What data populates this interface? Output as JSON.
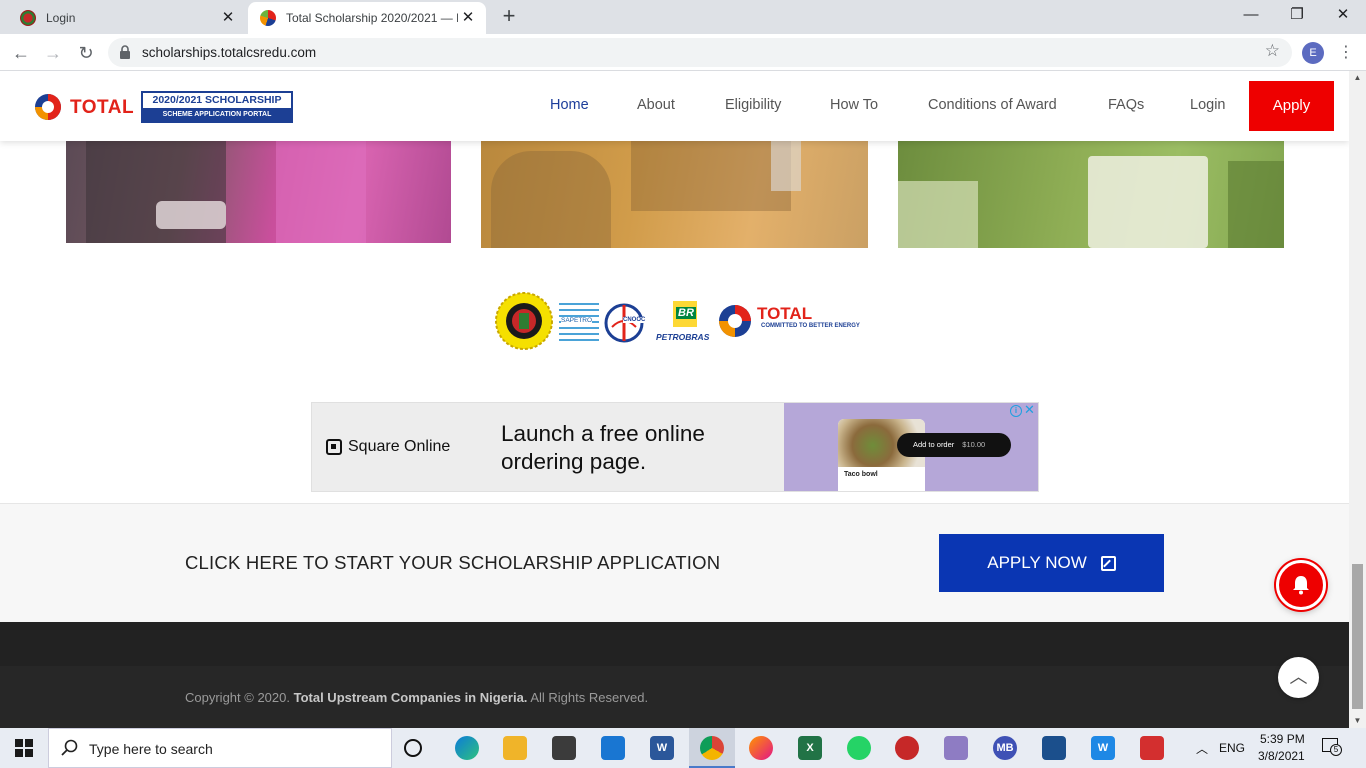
{
  "browser": {
    "tabs": [
      {
        "title": "Login",
        "close": "✕"
      },
      {
        "title": "Total Scholarship 2020/2021 — N",
        "close": "✕"
      }
    ],
    "new_tab": "+",
    "window": {
      "minimize": "—",
      "restore": "❐",
      "close": "✕"
    },
    "nav": {
      "back": "←",
      "forward": "→",
      "reload": "↻"
    },
    "url": "scholarships.totalcsredu.com",
    "profile_initial": "E"
  },
  "site": {
    "logo": {
      "word": "TOTAL",
      "badge_line1": "2020/2021 SCHOLARSHIP",
      "badge_line2": "SCHEME APPLICATION PORTAL"
    },
    "menu": [
      "Home",
      "About",
      "Eligibility",
      "How To",
      "Conditions of Award",
      "FAQs",
      "Login"
    ],
    "apply_label": "Apply",
    "partners": {
      "sapetro": "SAPETRO",
      "cnooc": "CNOOC",
      "br": "BR",
      "petrobras": "PETROBRAS",
      "total_word": "TOTAL",
      "total_tagline": "COMMITTED TO BETTER ENERGY"
    },
    "ad": {
      "brand": "Square Online",
      "headline": "Launch a free online ordering page.",
      "card_caption": "Taco bowl",
      "pill_label": "Add to order",
      "pill_price": "$10.00",
      "adchoice": "i",
      "close": "✕"
    },
    "cta": {
      "text": "CLICK HERE TO START YOUR SCHOLARSHIP APPLICATION",
      "button": "APPLY NOW"
    },
    "footer": {
      "copy_prefix": "Copyright © 2020.",
      "copy_bold": "Total Upstream Companies in Nigeria.",
      "copy_suffix": "All Rights Reserved."
    },
    "to_top": "︿"
  },
  "taskbar": {
    "search_placeholder": "Type here to search",
    "lang": "ENG",
    "time": "5:39 PM",
    "date": "3/8/2021",
    "notif_count": "5"
  },
  "colors": {
    "accent_red": "#ee0000",
    "accent_blue": "#0a36b3",
    "nav_active": "#1d3e9b"
  }
}
